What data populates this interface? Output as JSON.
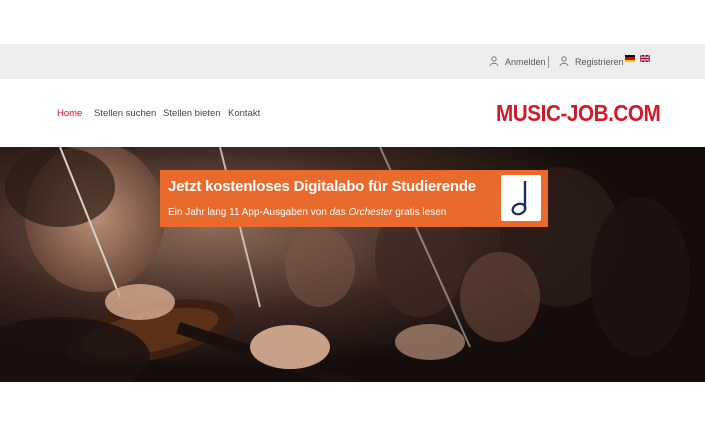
{
  "topbar": {
    "login_label": "Anmelden",
    "register_label": "Registrieren",
    "languages": [
      "de",
      "en"
    ]
  },
  "nav": {
    "items": [
      "Home",
      "Stellen suchen",
      "Stellen bieten",
      "Kontakt"
    ],
    "active": "Home"
  },
  "logo": {
    "text": "MUSIC-JOB.COM"
  },
  "banner": {
    "title": "Jetzt kostenloses Digitalabo für Studierende",
    "subtitle_prefix": "Ein Jahr lang 11 App-Ausgaben von ",
    "subtitle_italic": "das Orchester",
    "subtitle_suffix": " gratis lesen"
  },
  "colors": {
    "brand_red": "#d3192b",
    "banner_orange": "#e86a2c",
    "topbar_bg": "#ededed"
  },
  "icons": [
    "user-login-icon",
    "user-register-icon",
    "music-note-icon"
  ]
}
